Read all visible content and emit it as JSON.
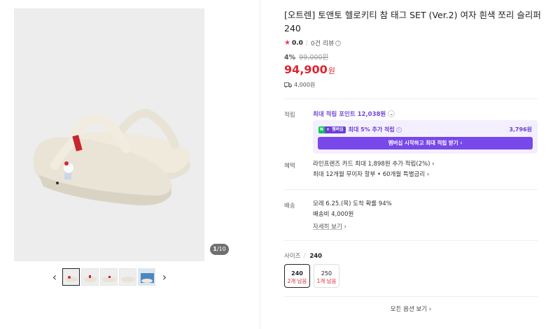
{
  "gallery": {
    "counter_current": "1",
    "counter_total": "/10",
    "prev_icon": "chevron-left-icon",
    "next_icon": "chevron-right-icon",
    "thumbnail_count": 5
  },
  "product": {
    "title": "[오트렌] 토앤토 헬로키티 참 태그 SET (Ver.2) 여자 흰색 쪼리 슬리퍼 240",
    "rating_score": "0.0",
    "reviews_label": "0건 리뷰",
    "discount": "4%",
    "original_price": "99,000원",
    "price": "94,900",
    "price_unit": "원",
    "shipping_fee": "4,000원"
  },
  "points": {
    "label": "적립",
    "max_points": "최대 적립 포인트 12,038원",
    "member_text": "최대 5% 추가 적립",
    "member_amount": "3,796원",
    "badge_n": "N",
    "badge_plus": "+",
    "badge_member": "멤버십",
    "member_button": "멤버십 시작하고 최대 적립 받기 ›"
  },
  "benefits": {
    "label": "혜택",
    "line1": "라인프렌즈 카드 최대 1,898원 추가 적립(2%) ›",
    "line2": "최대 12개월 무이자 할부 • 60개월 특별금리 ›"
  },
  "delivery": {
    "label": "배송",
    "line1": "모레 6.25.(목) 도착 확률 94%",
    "line2": "배송비 4,000원",
    "details_link": "자세히 보기",
    "details_chev": "›"
  },
  "size": {
    "label": "사이즈",
    "sep": "/",
    "selected": "240",
    "options": [
      {
        "size": "240",
        "stock": "2개 남음"
      },
      {
        "size": "250",
        "stock": "1개 남음"
      }
    ],
    "all_options": "모든 옵션 보기 ›"
  },
  "colors": {
    "accent_red": "#e0242f",
    "accent_purple": "#7848ea",
    "naver_green": "#03c75a"
  }
}
